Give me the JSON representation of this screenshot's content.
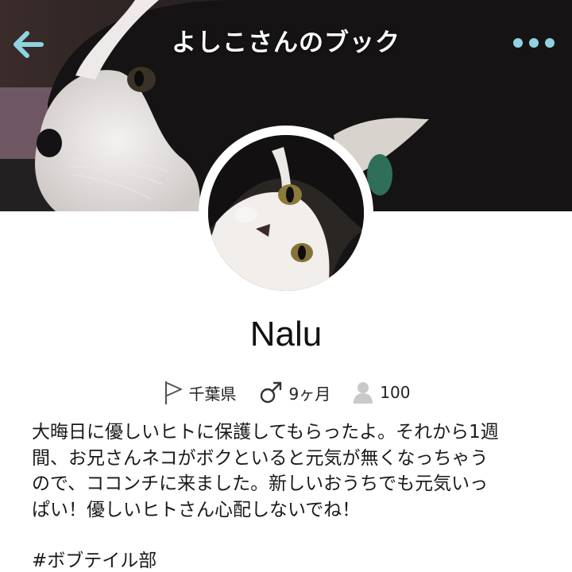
{
  "header": {
    "title": "よしこさんのブック",
    "back_icon": "arrow-left-icon",
    "more_icon": "more-dots-icon",
    "accent_color": "#8fd3e0"
  },
  "profile": {
    "name": "Nalu",
    "location": "千葉県",
    "location_icon": "flag-icon",
    "gender_icon": "male-icon",
    "age": "9ヶ月",
    "followers_icon": "person-icon",
    "followers": "100"
  },
  "bio": {
    "lines": [
      "大晦日に優しいヒトに保護してもらったよ。それから1週",
      "間、お兄さんネコがボクといると元気が無くなっちゃう",
      "ので、ココンチに来ました。新しいおうちでも元気いっ",
      "ぱい！優しいヒトさん心配しないでね！"
    ],
    "hashtag": "#ボブテイル部"
  }
}
